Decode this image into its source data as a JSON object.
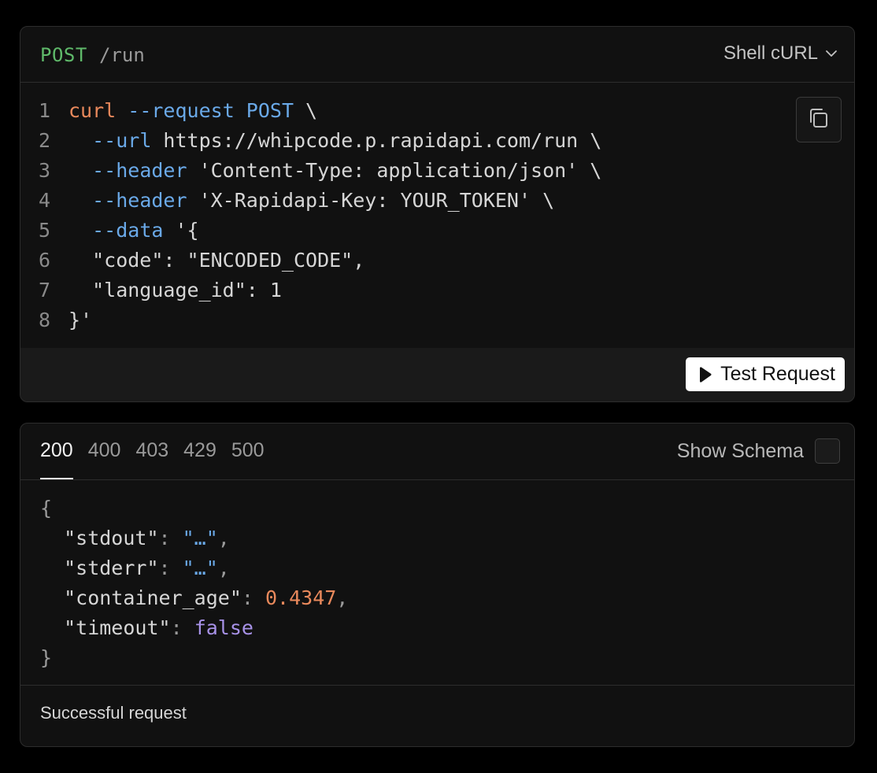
{
  "request": {
    "method": "POST",
    "path": "/run",
    "language_select": "Shell cURL",
    "code_lines": [
      {
        "n": "1",
        "parts": [
          {
            "t": "curl",
            "c": "cmd"
          },
          {
            "t": " ",
            "c": "plain"
          },
          {
            "t": "--request POST",
            "c": "flag"
          },
          {
            "t": " \\",
            "c": "plain"
          }
        ]
      },
      {
        "n": "2",
        "parts": [
          {
            "t": "  ",
            "c": "plain"
          },
          {
            "t": "--url",
            "c": "flag"
          },
          {
            "t": " https://whipcode.p.rapidapi.com/run \\",
            "c": "str"
          }
        ]
      },
      {
        "n": "3",
        "parts": [
          {
            "t": "  ",
            "c": "plain"
          },
          {
            "t": "--header",
            "c": "flag"
          },
          {
            "t": " 'Content-Type: application/json' \\",
            "c": "str"
          }
        ]
      },
      {
        "n": "4",
        "parts": [
          {
            "t": "  ",
            "c": "plain"
          },
          {
            "t": "--header",
            "c": "flag"
          },
          {
            "t": " 'X-Rapidapi-Key: YOUR_TOKEN' \\",
            "c": "str"
          }
        ]
      },
      {
        "n": "5",
        "parts": [
          {
            "t": "  ",
            "c": "plain"
          },
          {
            "t": "--data",
            "c": "flag"
          },
          {
            "t": " '{",
            "c": "str"
          }
        ]
      },
      {
        "n": "6",
        "parts": [
          {
            "t": "  \"code\": \"ENCODED_CODE\",",
            "c": "str"
          }
        ]
      },
      {
        "n": "7",
        "parts": [
          {
            "t": "  \"language_id\": 1",
            "c": "str"
          }
        ]
      },
      {
        "n": "8",
        "parts": [
          {
            "t": "}'",
            "c": "str"
          }
        ]
      }
    ],
    "copy_icon": "copy-icon",
    "test_button": "Test Request",
    "test_icon": "play-icon"
  },
  "response": {
    "status_tabs": [
      "200",
      "400",
      "403",
      "429",
      "500"
    ],
    "active_tab": "200",
    "schema_label": "Show Schema",
    "schema_checked": false,
    "json_lines": [
      [
        {
          "t": "{",
          "c": "punct"
        }
      ],
      [
        {
          "t": "  \"stdout\"",
          "c": "key"
        },
        {
          "t": ": ",
          "c": "punct"
        },
        {
          "t": "\"…\"",
          "c": "str"
        },
        {
          "t": ",",
          "c": "punct"
        }
      ],
      [
        {
          "t": "  \"stderr\"",
          "c": "key"
        },
        {
          "t": ": ",
          "c": "punct"
        },
        {
          "t": "\"…\"",
          "c": "str"
        },
        {
          "t": ",",
          "c": "punct"
        }
      ],
      [
        {
          "t": "  \"container_age\"",
          "c": "key"
        },
        {
          "t": ": ",
          "c": "punct"
        },
        {
          "t": "0.4347",
          "c": "num"
        },
        {
          "t": ",",
          "c": "punct"
        }
      ],
      [
        {
          "t": "  \"timeout\"",
          "c": "key"
        },
        {
          "t": ": ",
          "c": "punct"
        },
        {
          "t": "false",
          "c": "bool"
        }
      ],
      [
        {
          "t": "}",
          "c": "punct"
        }
      ]
    ],
    "description": "Successful request"
  },
  "colors": {
    "method": "#5fb96a",
    "command": "#e9895c",
    "flag": "#6aa9e8",
    "number": "#e9895c",
    "boolean": "#a892e8",
    "background": "#000000",
    "card": "#111111"
  }
}
